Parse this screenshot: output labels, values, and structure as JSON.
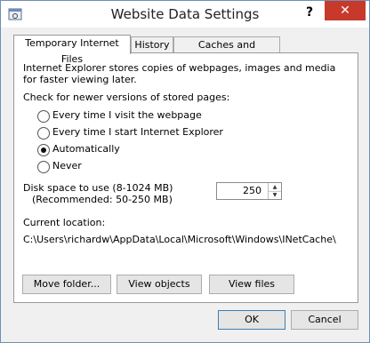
{
  "window": {
    "title": "Website Data Settings",
    "help_label": "?",
    "close_label": "✕",
    "icon": "ie-settings-icon"
  },
  "tabs": [
    {
      "label": "Temporary Internet Files",
      "active": true
    },
    {
      "label": "History",
      "active": false
    },
    {
      "label": "Caches and databases",
      "active": false
    }
  ],
  "panel": {
    "intro_line1": "Internet Explorer stores copies of webpages, images and media",
    "intro_line2": "for faster viewing later.",
    "check_label": "Check for newer versions of stored pages:",
    "radios": [
      {
        "label": "Every time I visit the webpage",
        "checked": false
      },
      {
        "label": "Every time I start Internet Explorer",
        "checked": false
      },
      {
        "label": "Automatically",
        "checked": true
      },
      {
        "label": "Never",
        "checked": false
      }
    ],
    "disk_label_line1": "Disk space to use (8-1024 MB)",
    "disk_label_line2": "(Recommended: 50-250 MB)",
    "disk_value": "250",
    "current_location_label": "Current location:",
    "current_location_path": "C:\\Users\\richardw\\AppData\\Local\\Microsoft\\Windows\\INetCache\\",
    "buttons": {
      "move_folder": "Move folder...",
      "view_objects": "View objects",
      "view_files": "View files"
    }
  },
  "dialog_buttons": {
    "ok": "OK",
    "cancel": "Cancel"
  }
}
